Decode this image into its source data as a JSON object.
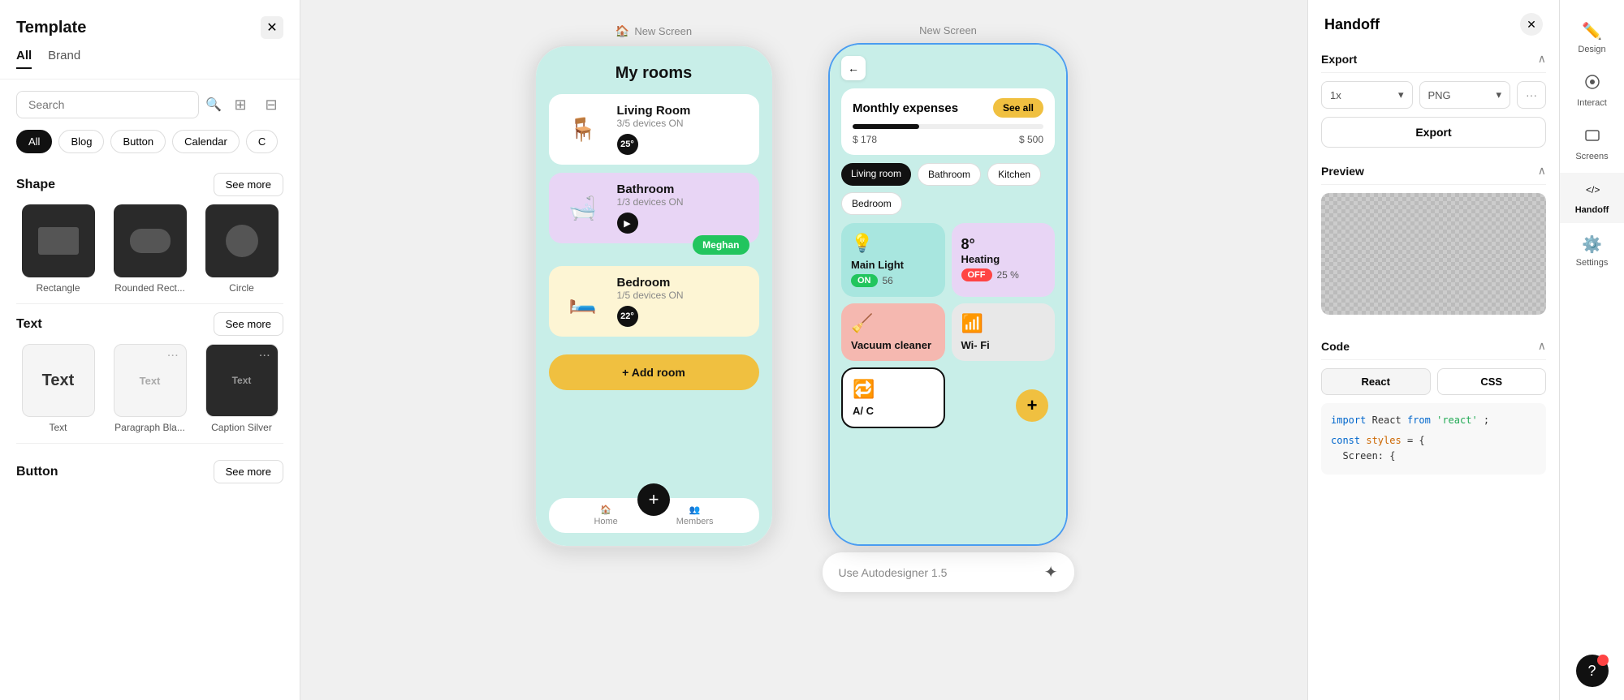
{
  "left_panel": {
    "title": "Template",
    "tabs": [
      "All",
      "Brand"
    ],
    "active_tab": "All",
    "search_placeholder": "Search",
    "filter_tags": [
      "All",
      "Blog",
      "Button",
      "Calendar",
      "C"
    ],
    "active_filter": "All",
    "shape_section": {
      "title": "Shape",
      "see_more": "See more",
      "items": [
        {
          "label": "Rectangle",
          "type": "rect"
        },
        {
          "label": "Rounded Rect...",
          "type": "rect-round"
        },
        {
          "label": "Circle",
          "type": "circle"
        }
      ]
    },
    "text_section": {
      "title": "Text",
      "see_more": "See more",
      "items": [
        {
          "label": "Text",
          "type": "text-large"
        },
        {
          "label": "Paragraph Bla...",
          "type": "text-small"
        },
        {
          "label": "Caption Silver",
          "type": "text-dark"
        }
      ]
    },
    "button_section": {
      "title": "Button",
      "see_more": "See more"
    }
  },
  "canvas": {
    "screen1_label": "New Screen",
    "screen2_label": "New Screen",
    "screen1": {
      "title": "My rooms",
      "rooms": [
        {
          "name": "Living Room",
          "devices": "3/5 devices ON",
          "temp": "25°",
          "bg": "white"
        },
        {
          "name": "Bathroom",
          "devices": "1/3 devices ON",
          "temp": "",
          "bg": "purple"
        },
        {
          "name": "Bedroom",
          "devices": "1/5 devices ON",
          "temp": "22°",
          "bg": "yellow"
        }
      ],
      "avatar": "Meghan",
      "add_room": "+ Add room",
      "nav_home": "Home",
      "nav_members": "Members"
    },
    "screen2": {
      "monthly_expenses": "Monthly expenses",
      "see_all": "See all",
      "amount_low": "$ 178",
      "amount_high": "$ 500",
      "room_filters": [
        "Living room",
        "Bathroom",
        "Kitchen",
        "Bedroom"
      ],
      "devices": [
        {
          "name": "Main Light",
          "status": "ON",
          "value": "56",
          "bg": "teal",
          "icon": "💡"
        },
        {
          "name": "Heating",
          "status": "OFF",
          "value": "25 %",
          "temp": "8°",
          "bg": "purple",
          "icon": "🌡️"
        },
        {
          "name": "Vacuum cleaner",
          "bg": "salmon",
          "icon": "🧹"
        },
        {
          "name": "Wi- Fi",
          "bg": "white-round",
          "icon": "📶"
        },
        {
          "name": "A/ C",
          "bg": "border",
          "icon": "🔁"
        },
        {
          "name": "+",
          "bg": "yellow",
          "icon": "+"
        }
      ]
    },
    "autodesigner": "Use Autodesigner 1.5"
  },
  "handoff_panel": {
    "title": "Handoff",
    "export_section": "Export",
    "scale": "1x",
    "format": "PNG",
    "export_btn": "Export",
    "preview_section": "Preview",
    "code_section": "Code",
    "code_tabs": [
      "React",
      "CSS"
    ],
    "active_code_tab": "React",
    "code_line1": "import React from 'react';",
    "code_line2": "const styles = {",
    "code_line3": "  Screen: {"
  },
  "far_right_nav": {
    "items": [
      {
        "label": "Design",
        "icon": "✏️"
      },
      {
        "label": "Interact",
        "icon": "⚙️"
      },
      {
        "label": "Screens",
        "icon": "📱"
      },
      {
        "label": "Handoff",
        "icon": "</>"
      },
      {
        "label": "Settings",
        "icon": "⚙️"
      }
    ],
    "active": "Handoff",
    "help_label": "?"
  }
}
